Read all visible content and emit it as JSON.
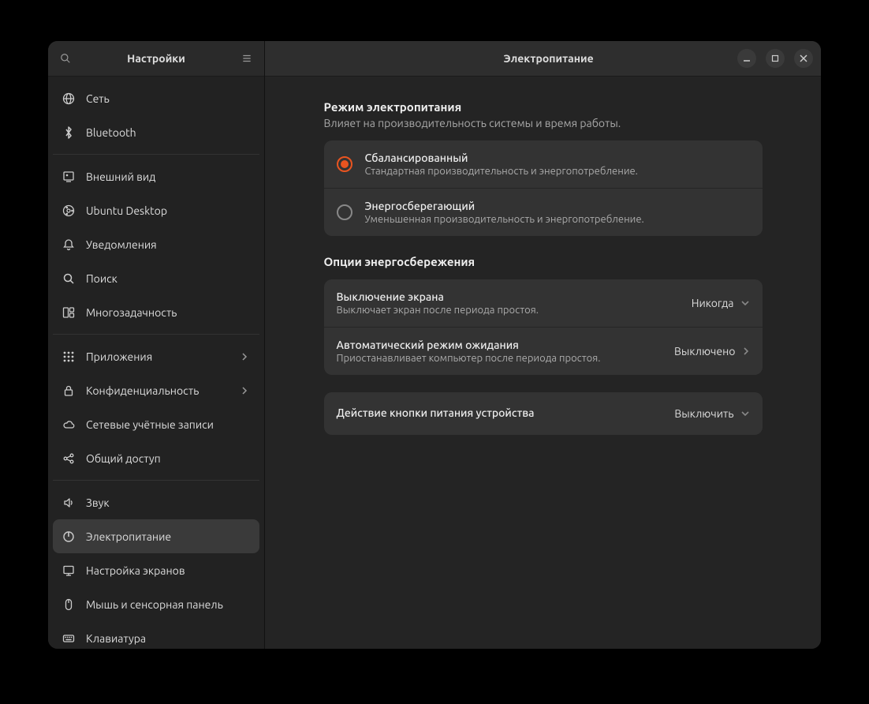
{
  "sidebar": {
    "title": "Настройки",
    "groups": [
      [
        {
          "icon": "globe",
          "label": "Сеть"
        },
        {
          "icon": "bluetooth",
          "label": "Bluetooth"
        }
      ],
      [
        {
          "icon": "appearance",
          "label": "Внешний вид"
        },
        {
          "icon": "ubuntu",
          "label": "Ubuntu Desktop"
        },
        {
          "icon": "bell",
          "label": "Уведомления"
        },
        {
          "icon": "search",
          "label": "Поиск"
        },
        {
          "icon": "multitask",
          "label": "Многозадачность"
        }
      ],
      [
        {
          "icon": "apps",
          "label": "Приложения",
          "chevron": true
        },
        {
          "icon": "lock",
          "label": "Конфиденциальность",
          "chevron": true
        },
        {
          "icon": "cloud",
          "label": "Сетевые учётные записи"
        },
        {
          "icon": "share",
          "label": "Общий доступ"
        }
      ],
      [
        {
          "icon": "sound",
          "label": "Звук"
        },
        {
          "icon": "power",
          "label": "Электропитание",
          "active": true
        },
        {
          "icon": "displays",
          "label": "Настройка экранов"
        },
        {
          "icon": "mouse",
          "label": "Мышь и сенсорная панель"
        },
        {
          "icon": "keyboard",
          "label": "Клавиатура"
        }
      ]
    ]
  },
  "main": {
    "title": "Электропитание",
    "mode_section": {
      "title": "Режим электропитания",
      "subtitle": "Влияет на производительность системы и время работы.",
      "options": [
        {
          "label": "Сбалансированный",
          "sub": "Стандартная производительность и энергопотребление.",
          "selected": true
        },
        {
          "label": "Энергосберегающий",
          "sub": "Уменьшенная производительность и энергопотребление.",
          "selected": false
        }
      ]
    },
    "saving_section": {
      "title": "Опции энергосбережения",
      "rows": [
        {
          "label": "Выключение экрана",
          "sub": "Выключает экран после периода простоя.",
          "value": "Никогда",
          "type": "dropdown"
        },
        {
          "label": "Автоматический режим ожидания",
          "sub": "Приостанавливает компьютер после периода простоя.",
          "value": "Выключено",
          "type": "nav"
        }
      ]
    },
    "button_section": {
      "rows": [
        {
          "label": "Действие кнопки питания устройства",
          "value": "Выключить",
          "type": "dropdown"
        }
      ]
    }
  }
}
